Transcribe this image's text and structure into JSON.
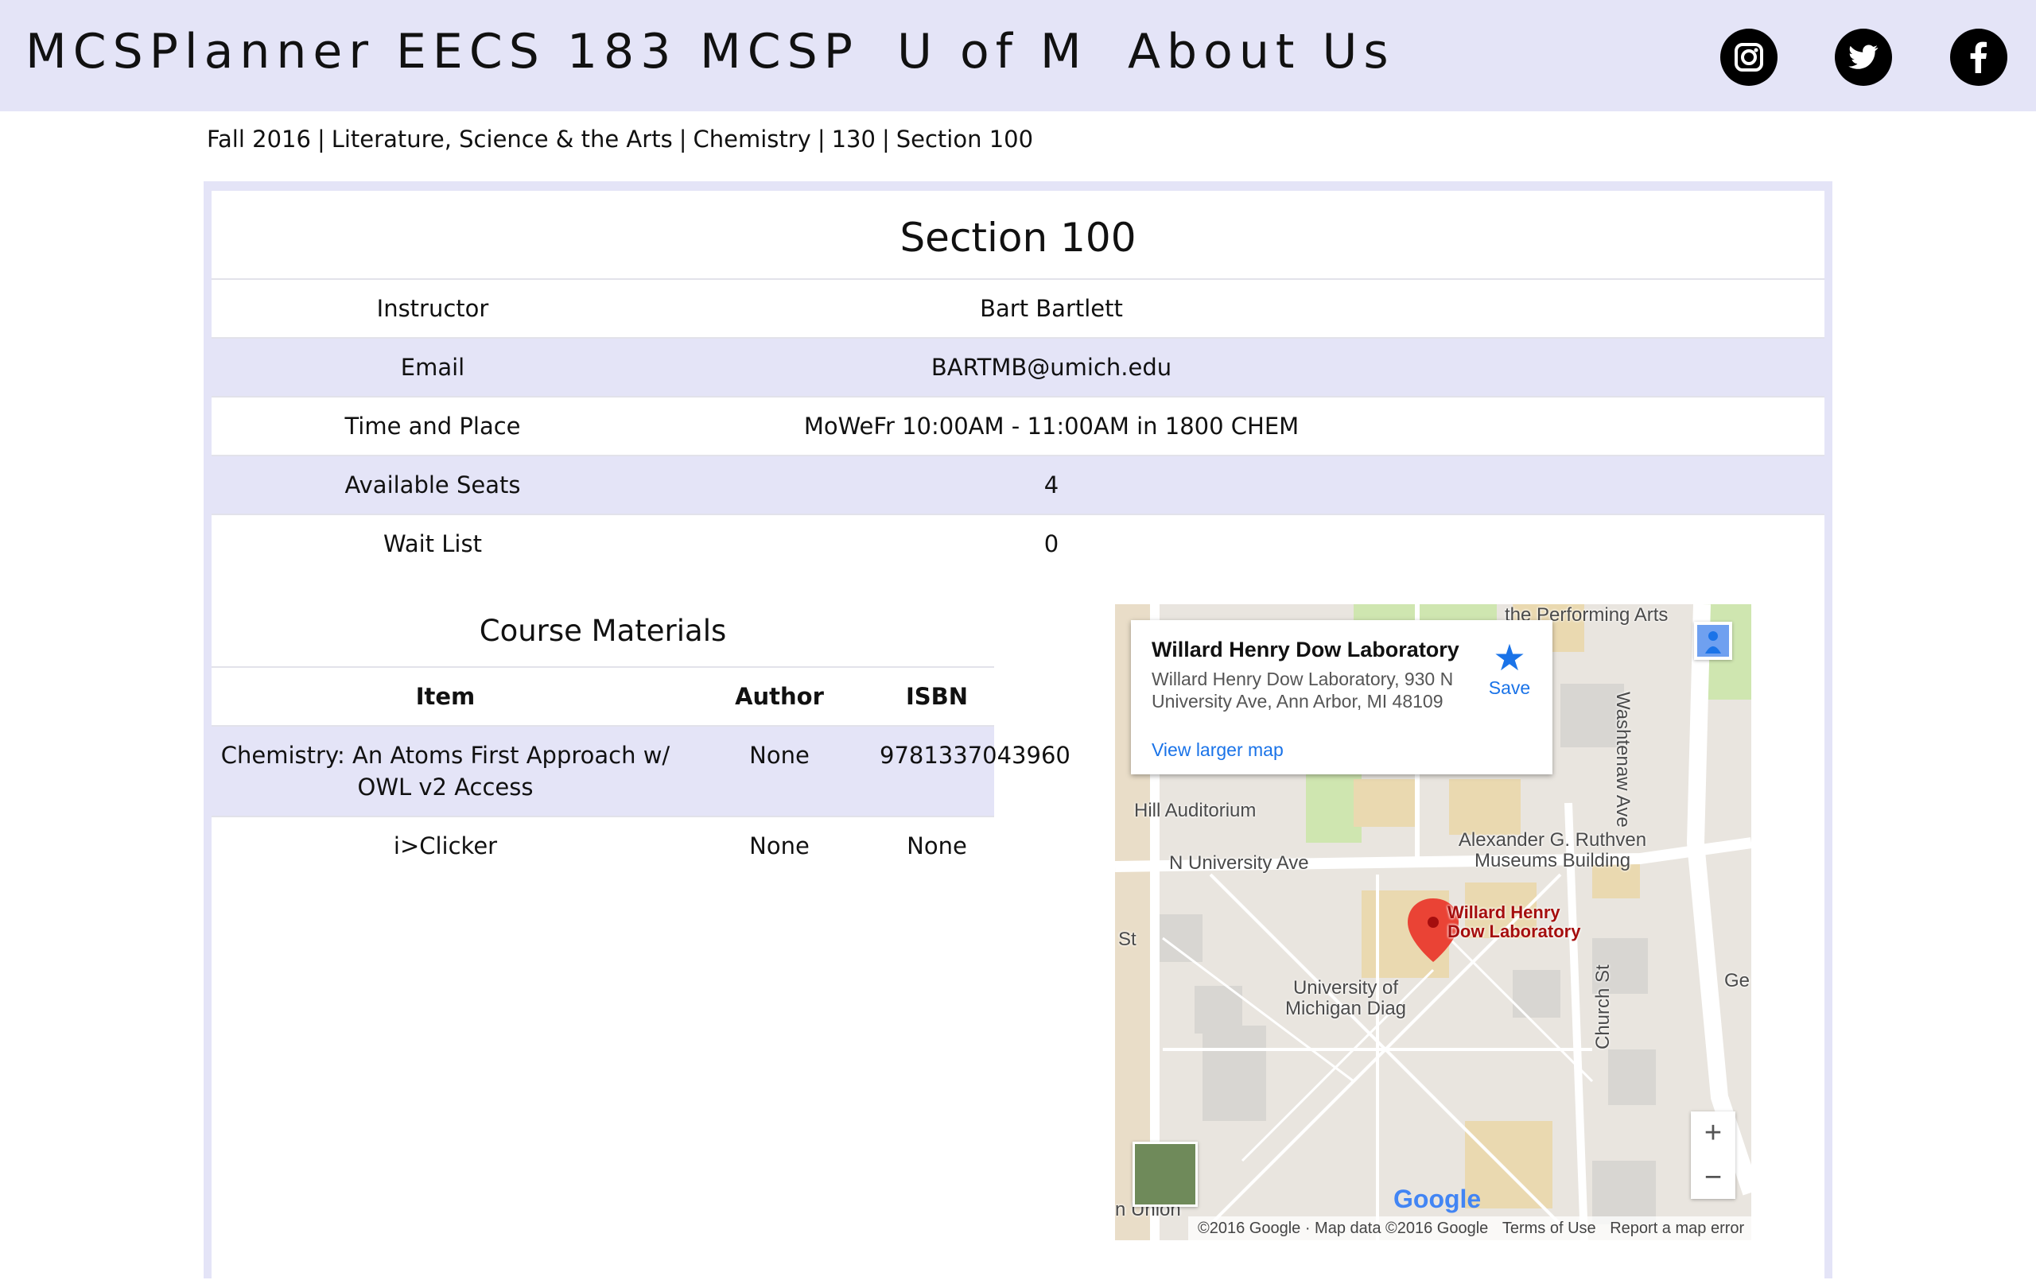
{
  "nav": {
    "links": [
      "MCSPlanner",
      "EECS 183",
      "MCSP",
      "U of M",
      "About Us"
    ],
    "social_icons": [
      "instagram-icon",
      "twitter-icon",
      "facebook-icon"
    ],
    "background": "#e4e4f7"
  },
  "breadcrumb": [
    "Fall 2016",
    "Literature, Science & the Arts",
    "Chemistry",
    "130",
    "Section 100"
  ],
  "section": {
    "title": "Section 100",
    "rows": [
      {
        "label": "Instructor",
        "value": "Bart Bartlett"
      },
      {
        "label": "Email",
        "value": "BARTMB@umich.edu"
      },
      {
        "label": "Time and Place",
        "value": "MoWeFr 10:00AM - 11:00AM in 1800 CHEM"
      },
      {
        "label": "Available Seats",
        "value": "4"
      },
      {
        "label": "Wait List",
        "value": "0"
      }
    ]
  },
  "materials": {
    "title": "Course Materials",
    "headers": [
      "Item",
      "Author",
      "ISBN"
    ],
    "rows": [
      {
        "item_line1": "Chemistry: An Atoms First Approach w/",
        "item_line2": "OWL v2 Access",
        "author": "None",
        "isbn": "9781337043960"
      },
      {
        "item_line1": "i>Clicker",
        "item_line2": "",
        "author": "None",
        "isbn": "None"
      }
    ]
  },
  "map": {
    "card": {
      "title": "Willard Henry Dow Laboratory",
      "address": "Willard Henry Dow Laboratory, 930 N University Ave, Ann Arbor, MI 48109",
      "save": "Save",
      "link": "View larger map"
    },
    "labels": {
      "performing_arts": "the Performing Arts",
      "hill": "Hill Auditorium",
      "museum": "Alexander G. Ruthven Museums Building",
      "university_ave": "N University Ave",
      "marker_label": "Willard Henry Dow Laboratory",
      "diag": "University of Michigan Diag",
      "washtenaw": "Washtenaw Ave",
      "church": "Church St",
      "st": "St",
      "ge": "Ge",
      "union": "n Union"
    },
    "zoom_in": "+",
    "zoom_out": "−",
    "logo": "Google",
    "footer": {
      "copyright": "©2016 Google · Map data ©2016 Google",
      "terms": "Terms of Use",
      "report": "Report a map error"
    }
  }
}
